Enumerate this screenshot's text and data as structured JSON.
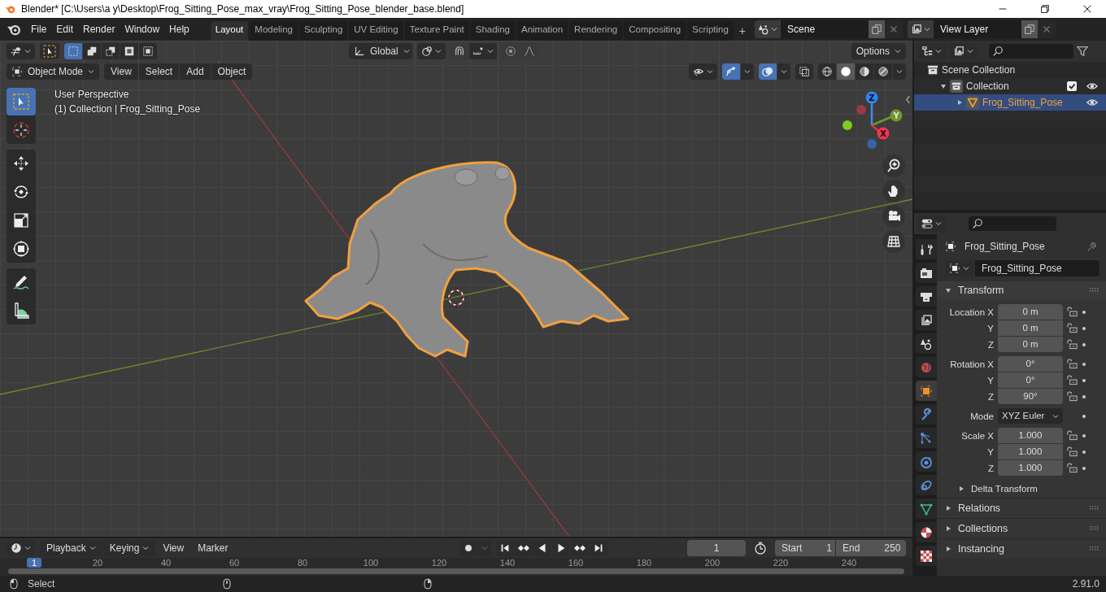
{
  "window": {
    "title": "Blender* [C:\\Users\\a y\\Desktop\\Frog_Sitting_Pose_max_vray\\Frog_Sitting_Pose_blender_base.blend]"
  },
  "menu": [
    "File",
    "Edit",
    "Render",
    "Window",
    "Help"
  ],
  "workspaces": [
    {
      "label": "Layout",
      "selected": true
    },
    {
      "label": "Modeling",
      "selected": false
    },
    {
      "label": "Sculpting",
      "selected": false
    },
    {
      "label": "UV Editing",
      "selected": false
    },
    {
      "label": "Texture Paint",
      "selected": false
    },
    {
      "label": "Shading",
      "selected": false
    },
    {
      "label": "Animation",
      "selected": false
    },
    {
      "label": "Rendering",
      "selected": false
    },
    {
      "label": "Compositing",
      "selected": false
    },
    {
      "label": "Scripting",
      "selected": false
    }
  ],
  "workspace_add": "+",
  "scene": {
    "name": "Scene"
  },
  "view_layer": {
    "name": "View Layer"
  },
  "tool_header": {
    "select_modes": [
      {
        "selected": true
      },
      {
        "selected": false
      },
      {
        "selected": false
      },
      {
        "selected": false
      },
      {
        "selected": false
      }
    ],
    "orientation": "Global",
    "options": "Options"
  },
  "viewport_header": {
    "mode": "Object Mode",
    "menus": [
      "View",
      "Select",
      "Add",
      "Object"
    ],
    "gizmos_on": true,
    "overlays_on": true,
    "shading": [
      {
        "kind": "wireframe",
        "selected": false
      },
      {
        "kind": "solid",
        "selected": true
      },
      {
        "kind": "material",
        "selected": false
      },
      {
        "kind": "rendered",
        "selected": false
      }
    ]
  },
  "toolbar": [
    {
      "tools": [
        {
          "kind": "select",
          "selected": true
        },
        {
          "kind": "cursor",
          "selected": false
        }
      ]
    },
    {
      "tools": [
        {
          "kind": "move",
          "selected": false
        },
        {
          "kind": "rotate",
          "selected": false
        },
        {
          "kind": "scale",
          "selected": false
        },
        {
          "kind": "transform",
          "selected": false
        }
      ]
    },
    {
      "tools": [
        {
          "kind": "annotate",
          "selected": false
        },
        {
          "kind": "measure",
          "selected": false
        }
      ]
    }
  ],
  "viewport": {
    "view_name": "User Perspective",
    "object_info": "(1) Collection | Frog_Sitting_Pose",
    "axes": [
      {
        "label": "Z"
      },
      {
        "label": "Y"
      },
      {
        "label": "X"
      }
    ]
  },
  "outliner": {
    "items": [
      {
        "label": "Scene Collection",
        "kind": "scene_collection",
        "children": [
          {
            "label": "Collection",
            "kind": "collection",
            "expanded": true,
            "checked": true,
            "children": [
              {
                "label": "Frog_Sitting_Pose",
                "kind": "mesh",
                "expanded": false,
                "selected": true
              }
            ]
          }
        ]
      }
    ]
  },
  "properties": {
    "tabs": [
      {
        "kind": "tool",
        "selected": false
      },
      {
        "kind": "render",
        "selected": false
      },
      {
        "kind": "output",
        "selected": false
      },
      {
        "kind": "view_layer",
        "selected": false
      },
      {
        "kind": "scene",
        "selected": false
      },
      {
        "kind": "world",
        "selected": false
      },
      {
        "kind": "object",
        "selected": true
      },
      {
        "kind": "modifiers",
        "selected": false
      },
      {
        "kind": "particles",
        "selected": false
      },
      {
        "kind": "physics",
        "selected": false
      },
      {
        "kind": "constraints",
        "selected": false
      },
      {
        "kind": "data",
        "selected": false
      },
      {
        "kind": "material",
        "selected": false
      },
      {
        "kind": "texture",
        "selected": false
      }
    ],
    "object_name": "Frog_Sitting_Pose",
    "datablock": "Frog_Sitting_Pose",
    "transform": {
      "title": "Transform",
      "expanded": true,
      "groups": [
        {
          "fields": [
            {
              "label": "Location X",
              "value": "0 m",
              "kind": "number"
            },
            {
              "label": "Y",
              "value": "0 m",
              "kind": "number"
            },
            {
              "label": "Z",
              "value": "0 m",
              "kind": "number"
            }
          ]
        },
        {
          "fields": [
            {
              "label": "Rotation X",
              "value": "0°",
              "kind": "number"
            },
            {
              "label": "Y",
              "value": "0°",
              "kind": "number"
            },
            {
              "label": "Z",
              "value": "90°",
              "kind": "number"
            }
          ]
        },
        {
          "fields": [
            {
              "label": "Mode",
              "value": "XYZ Euler",
              "kind": "dropdown"
            }
          ]
        },
        {
          "fields": [
            {
              "label": "Scale X",
              "value": "1.000",
              "kind": "number"
            },
            {
              "label": "Y",
              "value": "1.000",
              "kind": "number"
            },
            {
              "label": "Z",
              "value": "1.000",
              "kind": "number"
            }
          ]
        }
      ],
      "subpanels": [
        {
          "title": "Delta Transform",
          "expanded": false
        }
      ]
    },
    "panels": [
      {
        "title": "Relations",
        "expanded": false
      },
      {
        "title": "Collections",
        "expanded": false
      },
      {
        "title": "Instancing",
        "expanded": false
      }
    ]
  },
  "timeline": {
    "menus": [
      "Playback",
      "Keying",
      "View",
      "Marker"
    ],
    "frame": "1",
    "start_label": "Start",
    "start": "1",
    "end_label": "End",
    "end": "250",
    "playhead": "1",
    "ruler": [
      "20",
      "40",
      "60",
      "80",
      "100",
      "120",
      "140",
      "160",
      "180",
      "200",
      "220",
      "240"
    ]
  },
  "status_bar": {
    "action": "Select",
    "version": "2.91.0"
  }
}
